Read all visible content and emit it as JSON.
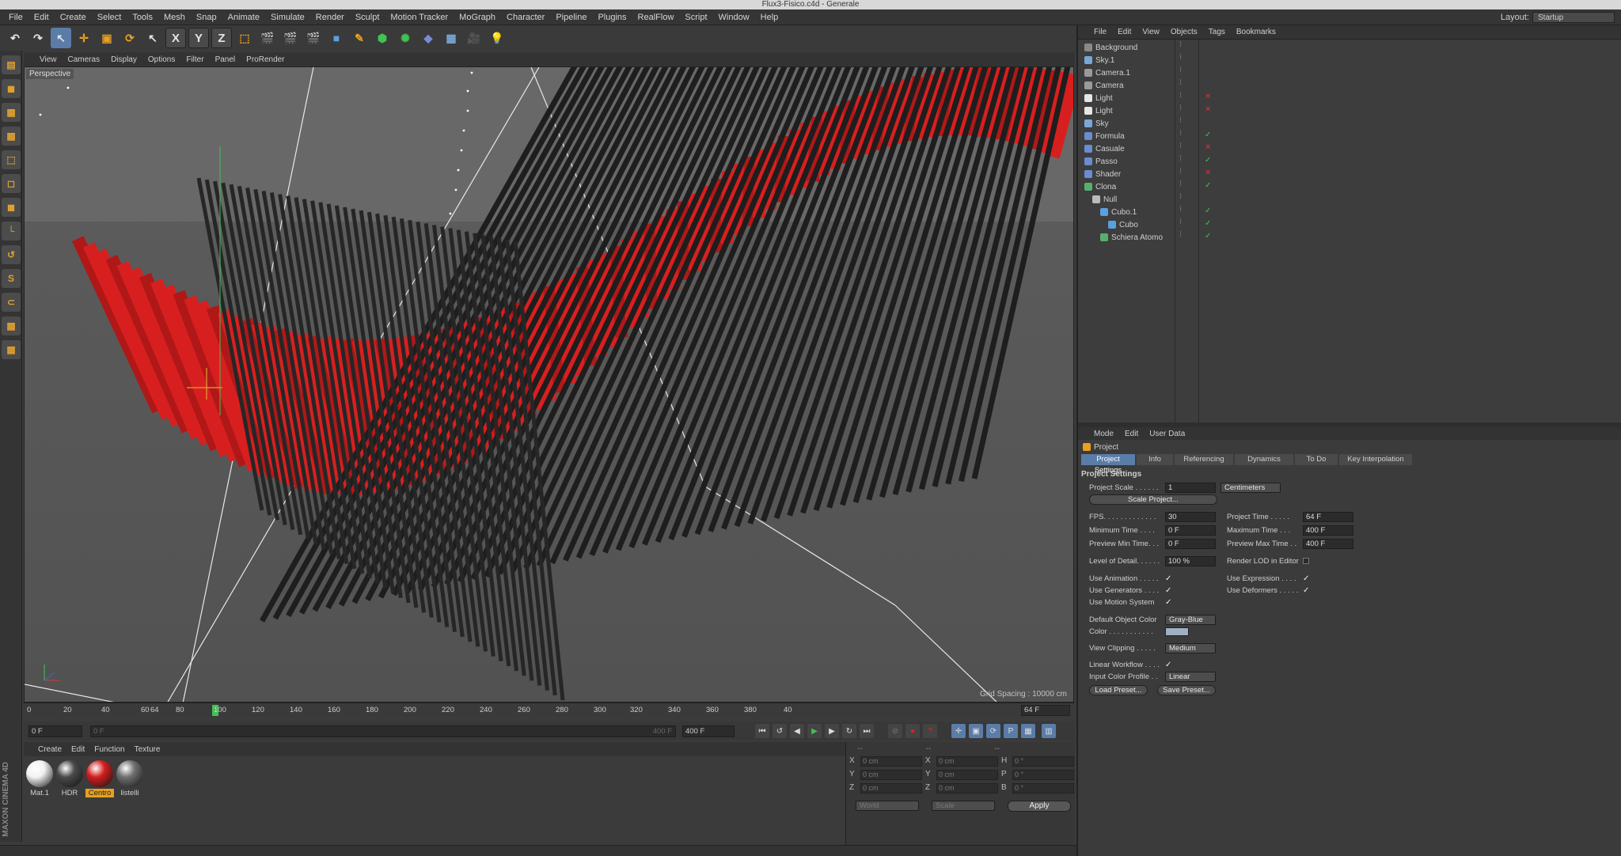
{
  "window_title": "Flux3-Fisico.c4d - Generale",
  "menu": [
    "File",
    "Edit",
    "Create",
    "Select",
    "Tools",
    "Mesh",
    "Snap",
    "Animate",
    "Simulate",
    "Render",
    "Sculpt",
    "Motion Tracker",
    "MoGraph",
    "Character",
    "Pipeline",
    "Plugins",
    "RealFlow",
    "Script",
    "Window",
    "Help"
  ],
  "layout": {
    "label": "Layout:",
    "value": "Startup"
  },
  "toolbar": {
    "axes": [
      "X",
      "Y",
      "Z"
    ]
  },
  "viewport": {
    "menu": [
      "View",
      "Cameras",
      "Display",
      "Options",
      "Filter",
      "Panel",
      "ProRender"
    ],
    "label": "Perspective",
    "grid_spacing": "Grid Spacing : 10000 cm"
  },
  "timeline": {
    "ticks": [
      "0",
      "20",
      "40",
      "60",
      "64",
      "80",
      "100",
      "120",
      "140",
      "160",
      "180",
      "200",
      "220",
      "240",
      "260",
      "280",
      "300",
      "320",
      "340",
      "360",
      "380",
      "40"
    ],
    "current_frame": "64 F",
    "start_field": "0 F",
    "slider_start": "0 F",
    "slider_end": "400 F",
    "end_field": "400 F"
  },
  "materials": {
    "menu": [
      "Create",
      "Edit",
      "Function",
      "Texture"
    ],
    "items": [
      {
        "name": "Mat.1",
        "color": "#f2f2f2"
      },
      {
        "name": "HDR",
        "color": "#4a4a4a"
      },
      {
        "name": "Centro",
        "color": "#d21f1f",
        "selected": true
      },
      {
        "name": "listelli",
        "color": "#707070"
      }
    ]
  },
  "coordinates": {
    "header_left": "--",
    "header_mid": "--",
    "header_right": "--",
    "rows": [
      {
        "a": "X",
        "av": "0 cm",
        "b": "X",
        "bv": "0 cm",
        "c": "H",
        "cv": "0 °"
      },
      {
        "a": "Y",
        "av": "0 cm",
        "b": "Y",
        "bv": "0 cm",
        "c": "P",
        "cv": "0 °"
      },
      {
        "a": "Z",
        "av": "0 cm",
        "b": "Z",
        "bv": "0 cm",
        "c": "B",
        "cv": "0 °"
      }
    ],
    "world": "World",
    "scale": "Scale",
    "apply": "Apply"
  },
  "object_manager": {
    "menu": [
      "File",
      "Edit",
      "View",
      "Objects",
      "Tags",
      "Bookmarks"
    ],
    "objects": [
      {
        "name": "Background",
        "indent": 0,
        "color": "#8a8a8a",
        "status": ""
      },
      {
        "name": "Sky.1",
        "indent": 0,
        "color": "#7aa8d6",
        "status": ""
      },
      {
        "name": "Camera.1",
        "indent": 0,
        "color": "#9a9a9a",
        "status": ""
      },
      {
        "name": "Camera",
        "indent": 0,
        "color": "#9a9a9a",
        "status": ""
      },
      {
        "name": "Light",
        "indent": 0,
        "color": "#e6e6e6",
        "status": "✕"
      },
      {
        "name": "Light",
        "indent": 0,
        "color": "#e6e6e6",
        "status": "✕"
      },
      {
        "name": "Sky",
        "indent": 0,
        "color": "#7aa8d6",
        "status": ""
      },
      {
        "name": "Formula",
        "indent": 0,
        "color": "#6a8cd0",
        "status": "✓"
      },
      {
        "name": "Casuale",
        "indent": 0,
        "color": "#6a8cd0",
        "status": "✕"
      },
      {
        "name": "Passo",
        "indent": 0,
        "color": "#6a8cd0",
        "status": "✓"
      },
      {
        "name": "Shader",
        "indent": 0,
        "color": "#6a8cd0",
        "status": "✕"
      },
      {
        "name": "Clona",
        "indent": 0,
        "color": "#55b070",
        "status": "✓"
      },
      {
        "name": "Null",
        "indent": 1,
        "color": "#bbbbbb",
        "status": ""
      },
      {
        "name": "Cubo.1",
        "indent": 2,
        "color": "#5aa0e0",
        "status": "✓"
      },
      {
        "name": "Cubo",
        "indent": 3,
        "color": "#5aa0e0",
        "status": "✓"
      },
      {
        "name": "Schiera Atomo",
        "indent": 2,
        "color": "#55b070",
        "status": "✓"
      }
    ]
  },
  "attributes": {
    "menu": [
      "Mode",
      "Edit",
      "User Data"
    ],
    "title": "Project",
    "tabs": [
      "Project Settings",
      "Info",
      "Referencing",
      "Dynamics",
      "To Do",
      "Key Interpolation"
    ],
    "section": "Project Settings",
    "project_scale_label": "Project Scale . . . . . .",
    "project_scale_value": "1",
    "project_scale_unit": "Centimeters",
    "scale_button": "Scale Project...",
    "fps_label": "FPS. . . . . . . . . . . . .",
    "fps": "30",
    "project_time_label": "Project Time . . . . .",
    "project_time": "64 F",
    "min_time_label": "Minimum Time . . . .",
    "min_time": "0 F",
    "max_time_label": "Maximum Time . . .",
    "max_time": "400 F",
    "pmin_label": "Preview Min Time. . .",
    "pmin": "0 F",
    "pmax_label": "Preview Max Time . .",
    "pmax": "400 F",
    "lod_label": "Level of Detail. . . . . .",
    "lod": "100 %",
    "render_lod_label": "Render LOD in Editor",
    "use_anim": "Use Animation . . . . .",
    "use_expr": "Use Expression . . . .",
    "use_gen": "Use Generators . . . .",
    "use_def": "Use Deformers . . . . .",
    "use_motion": "Use Motion System",
    "doc_label": "Default Object Color",
    "doc_value": "Gray-Blue",
    "color_label": "Color . . . . . . . . . . .",
    "color_swatch": "#9fb0c4",
    "clip_label": "View Clipping . . . . .",
    "clip_value": "Medium",
    "lw_label": "Linear Workflow . . . .",
    "icp_label": "Input Color Profile . .",
    "icp_value": "Linear",
    "load_preset": "Load Preset...",
    "save_preset": "Save Preset..."
  },
  "colors": {
    "accent": "#5a7ca8",
    "red": "#d21f1f",
    "playhead": "#41c253"
  }
}
